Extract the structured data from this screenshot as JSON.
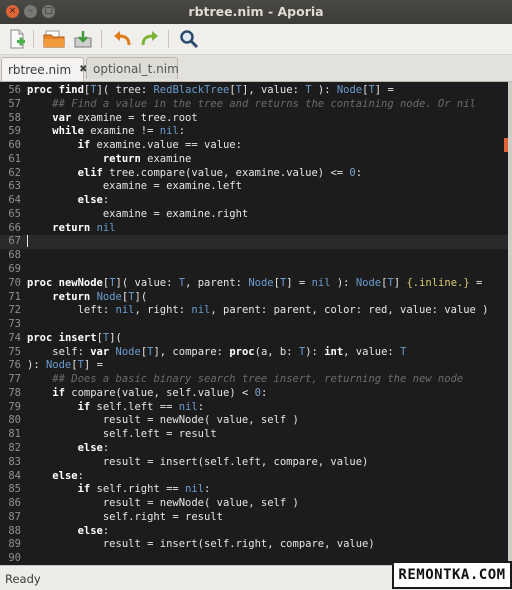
{
  "window": {
    "title": "rbtree.nim - Aporia",
    "buttons": {
      "close": "×",
      "minimize": "–",
      "maximize": "□"
    }
  },
  "toolbar": {
    "icons": [
      "new-file-icon",
      "open-folder-icon",
      "save-icon",
      "undo-icon",
      "redo-icon",
      "find-icon"
    ]
  },
  "tabs": [
    {
      "label": "rbtree.nim",
      "close": "✖",
      "active": true
    },
    {
      "label": "optional_t.nim",
      "active": false
    }
  ],
  "editor": {
    "current_line": 67,
    "lines": [
      {
        "n": "56",
        "html": "<span class=\"kw\">proc</span> <span class=\"kw\">find</span>[<span class=\"ty\">T</span>]( tree: <span class=\"ty\">RedBlackTree</span>[<span class=\"ty\">T</span>], value: <span class=\"ty\">T</span> ): <span class=\"ty\">Node</span>[<span class=\"ty\">T</span>] ="
      },
      {
        "n": "57",
        "html": "    <span class=\"cm\">## Find a value in the tree and returns the containing node. Or nil</span>"
      },
      {
        "n": "58",
        "html": "    <span class=\"kw\">var</span> examine = tree.root"
      },
      {
        "n": "59",
        "html": "    <span class=\"kw\">while</span> examine != <span class=\"ty\">nil</span>:"
      },
      {
        "n": "60",
        "html": "        <span class=\"kw\">if</span> examine.value == value:"
      },
      {
        "n": "61",
        "html": "            <span class=\"kw\">return</span> examine"
      },
      {
        "n": "62",
        "html": "        <span class=\"kw\">elif</span> tree.compare(value, examine.value) &lt;= <span class=\"num\">0</span>:"
      },
      {
        "n": "63",
        "html": "            examine = examine.left"
      },
      {
        "n": "64",
        "html": "        <span class=\"kw\">else</span>:"
      },
      {
        "n": "65",
        "html": "            examine = examine.right"
      },
      {
        "n": "66",
        "html": "    <span class=\"kw\">return</span> <span class=\"ty\">nil</span>"
      },
      {
        "n": "67",
        "html": "<span class=\"cursor\"></span>"
      },
      {
        "n": "68",
        "html": ""
      },
      {
        "n": "69",
        "html": ""
      },
      {
        "n": "70",
        "html": "<span class=\"kw\">proc</span> <span class=\"kw\">newNode</span>[<span class=\"ty\">T</span>]( value: <span class=\"ty\">T</span>, parent: <span class=\"ty\">Node</span>[<span class=\"ty\">T</span>] = <span class=\"ty\">nil</span> ): <span class=\"ty\">Node</span>[<span class=\"ty\">T</span>] <span class=\"pr\">{.inline.}</span> ="
      },
      {
        "n": "71",
        "html": "    <span class=\"kw\">return</span> <span class=\"ty\">Node</span>[<span class=\"ty\">T</span>]("
      },
      {
        "n": "72",
        "html": "        left: <span class=\"ty\">nil</span>, right: <span class=\"ty\">nil</span>, parent: parent, color: red, value: value )"
      },
      {
        "n": "73",
        "html": ""
      },
      {
        "n": "74",
        "html": "<span class=\"kw\">proc</span> <span class=\"kw\">insert</span>[<span class=\"ty\">T</span>]("
      },
      {
        "n": "75",
        "html": "    self: <span class=\"kw\">var</span> <span class=\"ty\">Node</span>[<span class=\"ty\">T</span>], compare: <span class=\"kw\">proc</span>(a, b: <span class=\"ty\">T</span>): <span class=\"kw\">int</span>, value: <span class=\"ty\">T</span>"
      },
      {
        "n": "76",
        "html": "): <span class=\"ty\">Node</span>[<span class=\"ty\">T</span>] ="
      },
      {
        "n": "77",
        "html": "    <span class=\"cm\">## Does a basic binary search tree insert, returning the new node</span>"
      },
      {
        "n": "78",
        "html": "    <span class=\"kw\">if</span> compare(value, self.value) &lt; <span class=\"num\">0</span>:"
      },
      {
        "n": "79",
        "html": "        <span class=\"kw\">if</span> self.left == <span class=\"ty\">nil</span>:"
      },
      {
        "n": "80",
        "html": "            result = newNode( value, self )"
      },
      {
        "n": "81",
        "html": "            self.left = result"
      },
      {
        "n": "82",
        "html": "        <span class=\"kw\">else</span>:"
      },
      {
        "n": "83",
        "html": "            result = insert(self.left, compare, value)"
      },
      {
        "n": "84",
        "html": "    <span class=\"kw\">else</span>:"
      },
      {
        "n": "85",
        "html": "        <span class=\"kw\">if</span> self.right == <span class=\"ty\">nil</span>:"
      },
      {
        "n": "86",
        "html": "            result = newNode( value, self )"
      },
      {
        "n": "87",
        "html": "            self.right = result"
      },
      {
        "n": "88",
        "html": "        <span class=\"kw\">else</span>:"
      },
      {
        "n": "89",
        "html": "            result = insert(self.right, compare, value)"
      },
      {
        "n": "90",
        "html": ""
      }
    ]
  },
  "statusbar": {
    "text": "Ready"
  },
  "watermark": {
    "text": "REMONTKA.COM"
  }
}
